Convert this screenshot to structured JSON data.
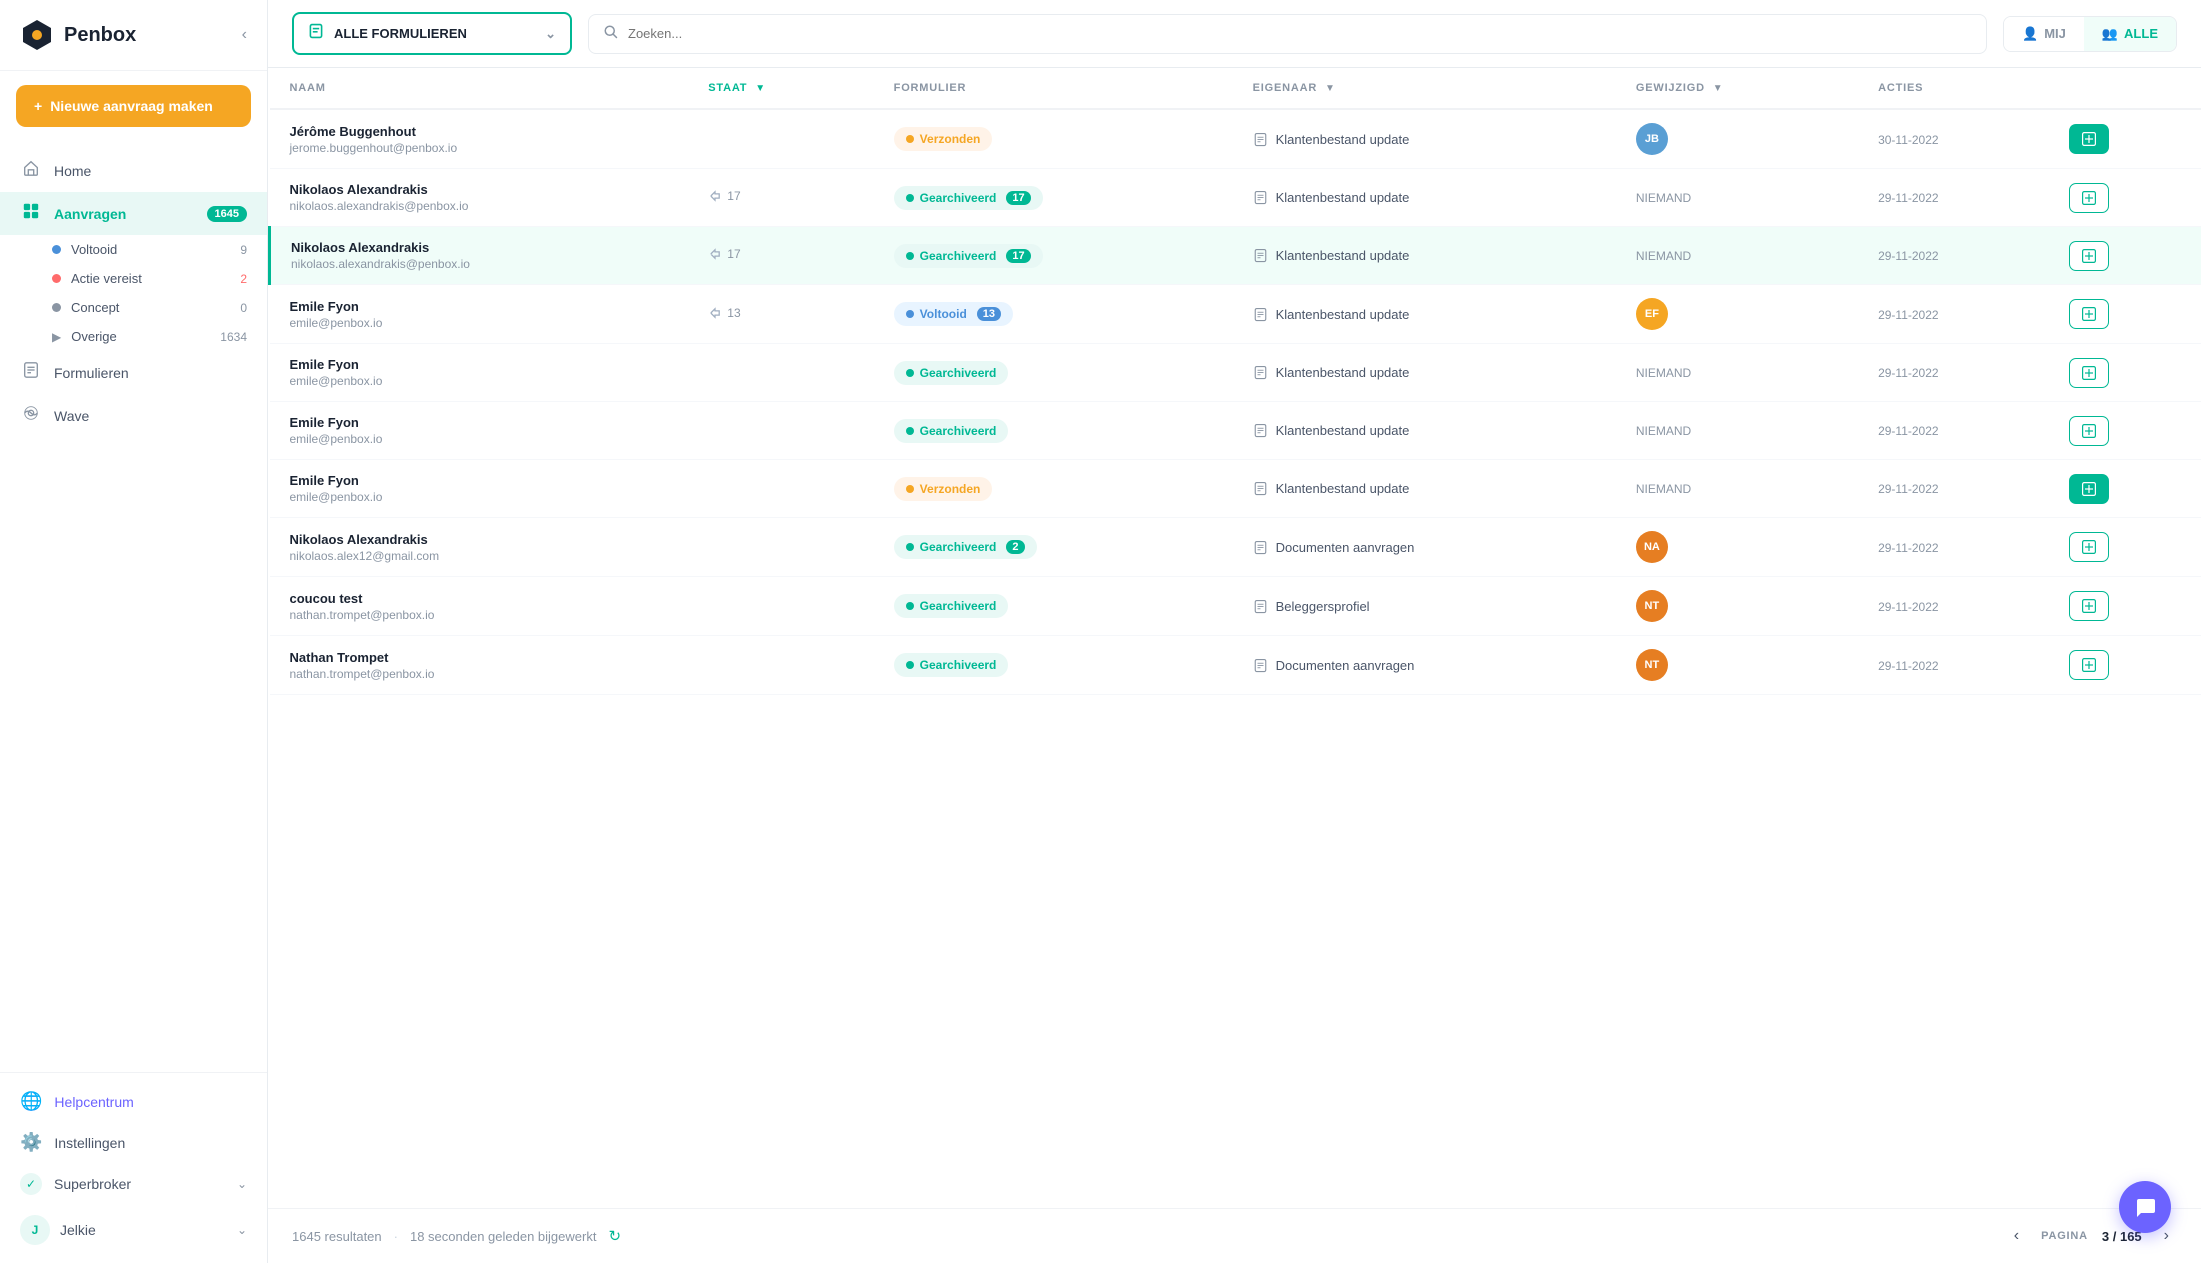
{
  "sidebar": {
    "logo": "Penbox",
    "new_request_label": "Nieuwe aanvraag maken",
    "nav_items": [
      {
        "id": "home",
        "label": "Home",
        "icon": "🏠",
        "badge": null
      },
      {
        "id": "aanvragen",
        "label": "Aanvragen",
        "icon": "📋",
        "badge": "1645",
        "active": true
      },
      {
        "id": "formulieren",
        "label": "Formulieren",
        "icon": "📄",
        "badge": null
      },
      {
        "id": "wave",
        "label": "Wave",
        "icon": "✦",
        "badge": null
      }
    ],
    "sub_items": [
      {
        "id": "voltooid",
        "label": "Voltooid",
        "color": "#4a90d9",
        "badge": "9"
      },
      {
        "id": "actie-vereist",
        "label": "Actie vereist",
        "color": "#ff6b6b",
        "badge": "2"
      },
      {
        "id": "concept",
        "label": "Concept",
        "color": "#8a95a3",
        "badge": "0"
      },
      {
        "id": "overige",
        "label": "Overige",
        "color": null,
        "badge": "1634",
        "has_expand": true
      }
    ],
    "bottom_items": [
      {
        "id": "helpcentrum",
        "label": "Helpcentrum",
        "icon": "🌐",
        "color": "#6c63ff"
      },
      {
        "id": "instellingen",
        "label": "Instellingen",
        "icon": "⚙️",
        "color": null
      },
      {
        "id": "superbroker",
        "label": "Superbroker",
        "icon": "✓",
        "expandable": true
      },
      {
        "id": "jelkie",
        "label": "Jelkie",
        "icon": "👤",
        "expandable": true
      }
    ]
  },
  "topbar": {
    "dropdown_label": "ALLE FORMULIEREN",
    "search_placeholder": "Zoeken...",
    "view_mij": "MIJ",
    "view_alle": "ALLE"
  },
  "table": {
    "columns": [
      {
        "id": "naam",
        "label": "NAAM"
      },
      {
        "id": "staat",
        "label": "STAAT",
        "sortable": true,
        "accent": true
      },
      {
        "id": "formulier",
        "label": "FORMULIER"
      },
      {
        "id": "eigenaar",
        "label": "EIGENAAR",
        "sortable": true
      },
      {
        "id": "gewijzigd",
        "label": "GEWIJZIGD",
        "sortable": true
      },
      {
        "id": "acties",
        "label": "ACTIES"
      }
    ],
    "rows": [
      {
        "id": 1,
        "name": "Jérôme Buggenhout",
        "email": "jerome.buggenhout@penbox.io",
        "version": null,
        "status": "Verzonden",
        "status_type": "sent",
        "status_count": null,
        "formulier": "Klantenbestand update",
        "owner_type": "avatar",
        "owner_bg": "#5a9fd4",
        "owner_initials": "JB",
        "owner_none": false,
        "date": "30-11-2022",
        "action_type": "filled"
      },
      {
        "id": 2,
        "name": "Nikolaos Alexandrakis",
        "email": "nikolaos.alexandrakis@penbox.io",
        "version": "17",
        "status": "Gearchiveerd",
        "status_type": "archived",
        "status_count": "17",
        "formulier": "Klantenbestand update",
        "owner_type": "none",
        "owner_none": true,
        "date": "29-11-2022",
        "action_type": "outline"
      },
      {
        "id": 3,
        "name": "Nikolaos Alexandrakis",
        "email": "nikolaos.alexandrakis@penbox.io",
        "version": "17",
        "status": "Gearchiveerd",
        "status_type": "archived",
        "status_count": "17",
        "formulier": "Klantenbestand update",
        "owner_type": "none",
        "owner_none": true,
        "date": "29-11-2022",
        "action_type": "outline",
        "selected": true
      },
      {
        "id": 4,
        "name": "Emile Fyon",
        "email": "emile@penbox.io",
        "version": "13",
        "status": "Voltooid",
        "status_type": "complete",
        "status_count": "13",
        "status_count_color": "blue",
        "formulier": "Klantenbestand update",
        "owner_type": "initials",
        "owner_bg": "#f5a623",
        "owner_initials": "EF",
        "owner_none": false,
        "date": "29-11-2022",
        "action_type": "outline"
      },
      {
        "id": 5,
        "name": "Emile Fyon",
        "email": "emile@penbox.io",
        "version": null,
        "status": "Gearchiveerd",
        "status_type": "archived",
        "status_count": null,
        "formulier": "Klantenbestand update",
        "owner_type": "none",
        "owner_none": true,
        "date": "29-11-2022",
        "action_type": "outline"
      },
      {
        "id": 6,
        "name": "Emile Fyon",
        "email": "emile@penbox.io",
        "version": null,
        "status": "Gearchiveerd",
        "status_type": "archived",
        "status_count": null,
        "formulier": "Klantenbestand update",
        "owner_type": "none",
        "owner_none": true,
        "date": "29-11-2022",
        "action_type": "outline"
      },
      {
        "id": 7,
        "name": "Emile Fyon",
        "email": "emile@penbox.io",
        "version": null,
        "status": "Verzonden",
        "status_type": "sent",
        "status_count": null,
        "formulier": "Klantenbestand update",
        "owner_type": "none",
        "owner_none": true,
        "date": "29-11-2022",
        "action_type": "filled"
      },
      {
        "id": 8,
        "name": "Nikolaos Alexandrakis",
        "email": "nikolaos.alex12@gmail.com",
        "version": null,
        "status": "Gearchiveerd",
        "status_type": "archived",
        "status_count": "2",
        "formulier": "Documenten aanvragen",
        "owner_type": "initials",
        "owner_bg": "#e67e22",
        "owner_initials": "NA",
        "owner_none": false,
        "date": "29-11-2022",
        "action_type": "outline"
      },
      {
        "id": 9,
        "name": "coucou test",
        "email": "nathan.trompet@penbox.io",
        "version": null,
        "status": "Gearchiveerd",
        "status_type": "archived",
        "status_count": null,
        "formulier": "Beleggersprofiel",
        "owner_type": "initials",
        "owner_bg": "#e67e22",
        "owner_initials": "NT",
        "owner_none": false,
        "date": "29-11-2022",
        "action_type": "outline"
      },
      {
        "id": 10,
        "name": "Nathan Trompet",
        "email": "nathan.trompet@penbox.io",
        "version": null,
        "status": "Gearchiveerd",
        "status_type": "archived",
        "status_count": null,
        "formulier": "Documenten aanvragen",
        "owner_type": "initials",
        "owner_bg": "#e67e22",
        "owner_initials": "NT",
        "owner_none": false,
        "date": "29-11-2022",
        "action_type": "outline"
      }
    ]
  },
  "footer": {
    "results_count": "1645",
    "results_label": "resultaten",
    "updated_label": "18 seconden geleden bijgewerkt",
    "page_label": "PAGINA",
    "current_page": "3",
    "total_pages": "165"
  }
}
